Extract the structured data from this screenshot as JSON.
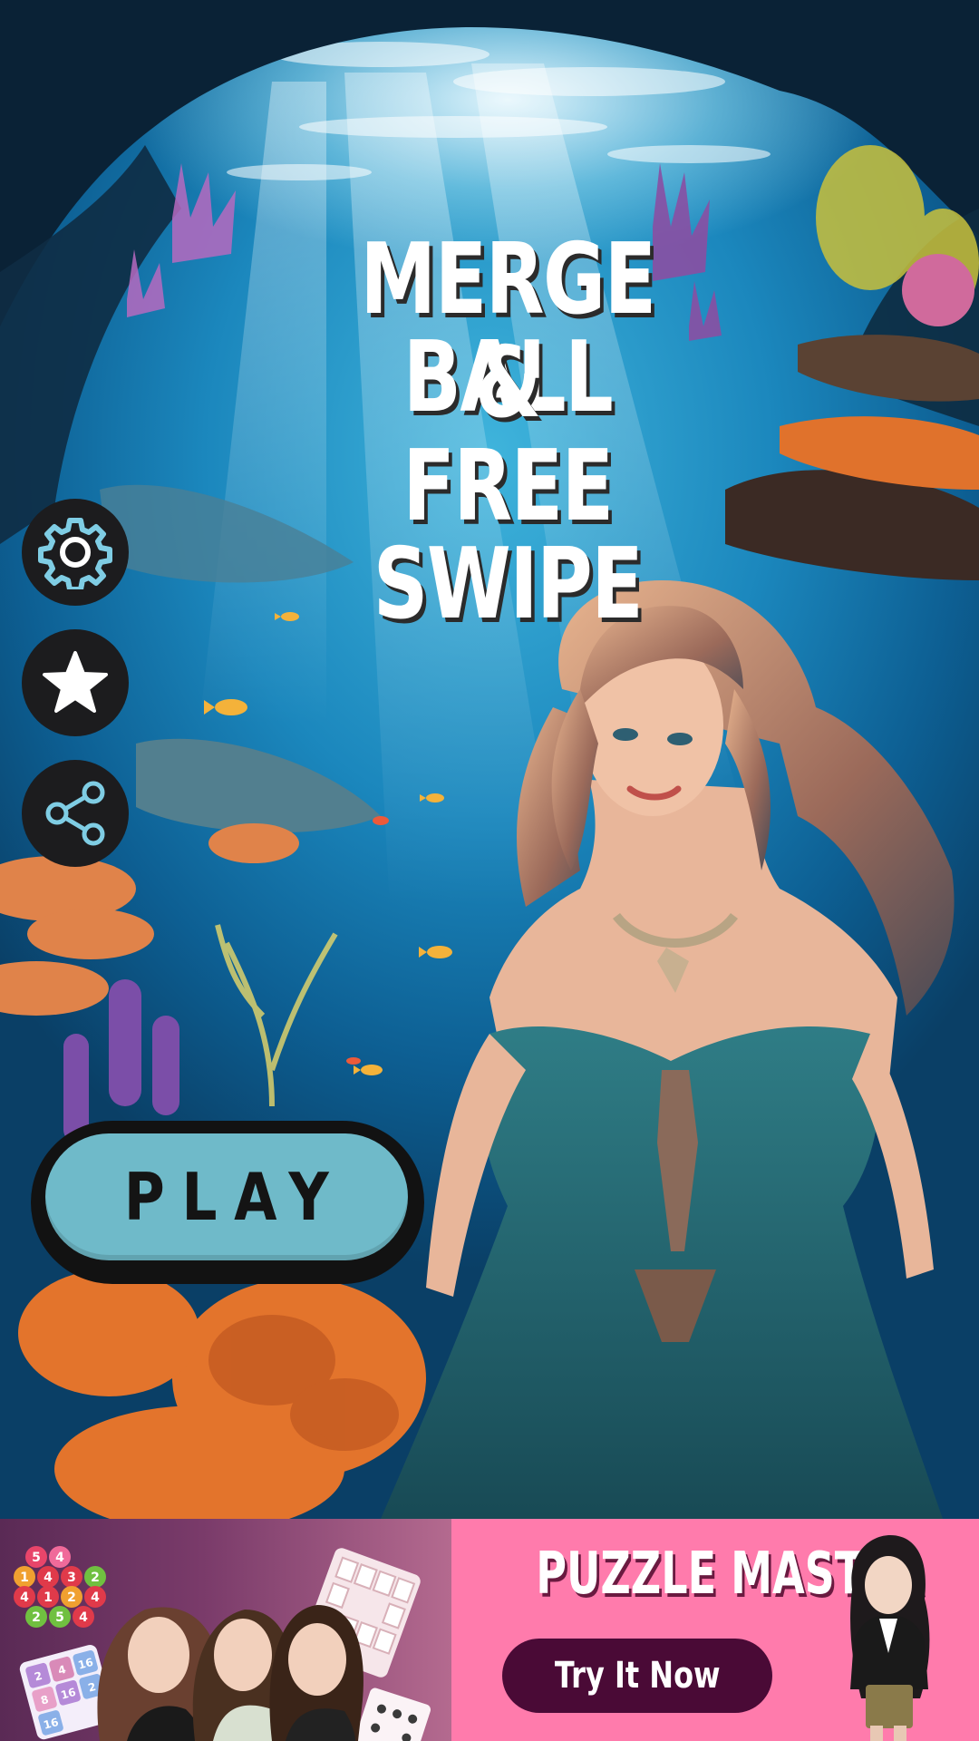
{
  "game": {
    "title_lines": [
      "MERGE BALL",
      "&",
      "FREE SWIPE"
    ]
  },
  "menu": {
    "play_label": "PLAY",
    "side_buttons": [
      {
        "name": "settings",
        "icon": "gear-icon"
      },
      {
        "name": "rate",
        "icon": "star-icon"
      },
      {
        "name": "share",
        "icon": "share-icon"
      }
    ]
  },
  "ad_banner": {
    "title": "PUZZLE MASTER",
    "cta_label": "Try It Now",
    "hex_numbers": [
      "5",
      "4",
      "1",
      "4",
      "3",
      "2",
      "4",
      "1",
      "2",
      "4",
      "2",
      "5",
      "4"
    ],
    "grid_numbers": [
      "2",
      "4",
      "16",
      "8",
      "16",
      "2",
      "16"
    ]
  },
  "colors": {
    "play_button": "#6fbac9",
    "icon_accent": "#7fcde4",
    "ad_pink": "#ff7bac",
    "ad_cta": "#4a0a36"
  }
}
